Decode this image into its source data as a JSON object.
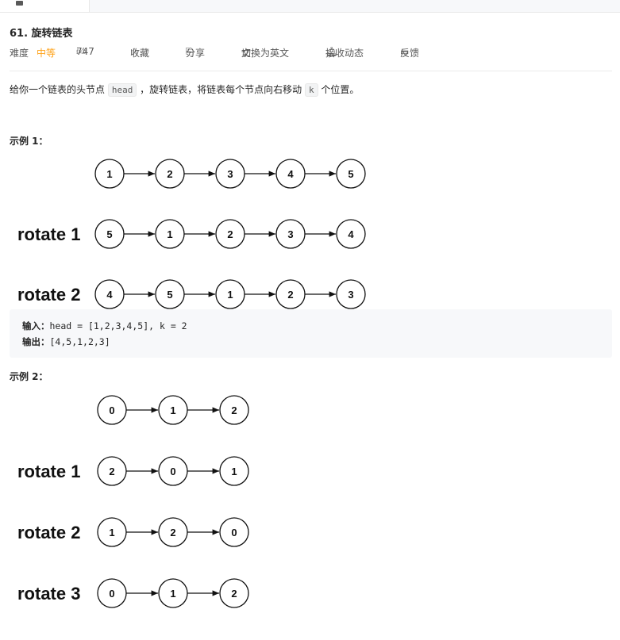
{
  "problem": {
    "title": "61. 旋转链表",
    "difficulty_label": "难度",
    "difficulty": "中等",
    "likes": "747",
    "collect": "收藏",
    "share": "分享",
    "switch_lang": "切换为英文",
    "subscribe": "接收动态",
    "feedback": "反馈",
    "desc_pre": "给你一个链表的头节点 ",
    "desc_code1": "head",
    "desc_mid": " ，旋转链表，将链表每个节点向右移动 ",
    "desc_code2": "k",
    "desc_post": " 个位置。"
  },
  "example1": {
    "title": "示例 1：",
    "diagram": {
      "rows": [
        {
          "label": "",
          "nodes": [
            "1",
            "2",
            "3",
            "4",
            "5"
          ]
        },
        {
          "label": "rotate 1",
          "nodes": [
            "5",
            "1",
            "2",
            "3",
            "4"
          ]
        },
        {
          "label": "rotate 2",
          "nodes": [
            "4",
            "5",
            "1",
            "2",
            "3"
          ]
        }
      ]
    },
    "input_label": "输入：",
    "input_value": "head = [1,2,3,4,5], k = 2",
    "output_label": "输出：",
    "output_value": "[4,5,1,2,3]"
  },
  "example2": {
    "title": "示例 2：",
    "diagram": {
      "rows": [
        {
          "label": "",
          "nodes": [
            "0",
            "1",
            "2"
          ]
        },
        {
          "label": "rotate 1",
          "nodes": [
            "2",
            "0",
            "1"
          ]
        },
        {
          "label": "rotate 2",
          "nodes": [
            "1",
            "2",
            "0"
          ]
        },
        {
          "label": "rotate 3",
          "nodes": [
            "0",
            "1",
            "2"
          ]
        }
      ]
    }
  }
}
